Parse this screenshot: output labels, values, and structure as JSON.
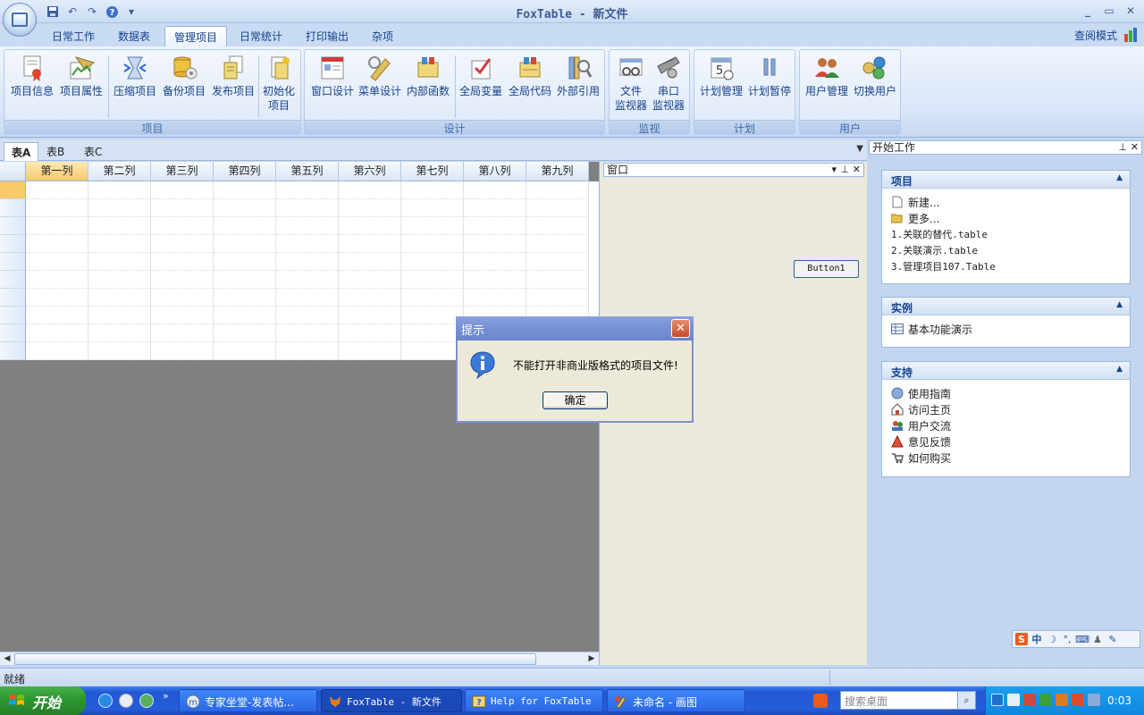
{
  "window": {
    "title": "FoxTable - 新文件"
  },
  "qat": {
    "save": "save-icon",
    "undo": "undo-icon",
    "redo": "redo-icon",
    "help": "help-icon",
    "more": "▾"
  },
  "ribbon": {
    "tabs": [
      "日常工作",
      "数据表",
      "管理项目",
      "日常统计",
      "打印输出",
      "杂项"
    ],
    "active_tab": "管理项目",
    "view_mode": "查阅模式",
    "groups": {
      "project": {
        "label": "项目",
        "buttons": [
          "项目信息",
          "项目属性",
          "压缩项目",
          "备份项目",
          "发布项目",
          "初始化",
          "项目"
        ]
      },
      "design": {
        "label": "设计",
        "buttons": [
          "窗口设计",
          "菜单设计",
          "内部函数",
          "全局变量",
          "全局代码",
          "外部引用"
        ]
      },
      "monitor": {
        "label": "监视",
        "buttons": [
          "文件",
          "监视器",
          "串口",
          "监视器"
        ]
      },
      "plan": {
        "label": "计划",
        "buttons": [
          "计划管理",
          "计划暂停"
        ]
      },
      "user": {
        "label": "用户",
        "buttons": [
          "用户管理",
          "切换用户"
        ]
      }
    }
  },
  "sheet_tabs": [
    "表A",
    "表B",
    "表C"
  ],
  "grid": {
    "columns": [
      "第一列",
      "第二列",
      "第三列",
      "第四列",
      "第五列",
      "第六列",
      "第七列",
      "第八列",
      "第九列"
    ]
  },
  "window_panel": {
    "title": "窗口",
    "button1": "Button1"
  },
  "task_pane": {
    "title": "开始工作",
    "project": {
      "title": "项目",
      "new": "新建...",
      "more": "更多...",
      "recent": [
        "1.关联的替代.table",
        "2.关联演示.table",
        "3.管理项目107.Table"
      ]
    },
    "examples": {
      "title": "实例",
      "items": [
        "基本功能演示"
      ]
    },
    "support": {
      "title": "支持",
      "items": [
        "使用指南",
        "访问主页",
        "用户交流",
        "意见反馈",
        "如何购买"
      ]
    }
  },
  "ime": {
    "label": "中"
  },
  "statusbar": {
    "text": "就绪"
  },
  "dialog": {
    "title": "提示",
    "message": "不能打开非商业版格式的项目文件!",
    "ok": "确定"
  },
  "taskbar": {
    "start": "开始",
    "buttons": [
      "专家坐堂-发表帖...",
      "FoxTable - 新文件",
      "Help for FoxTable",
      "未命名 - 画图"
    ],
    "search_placeholder": "搜索桌面",
    "clock": "0:03"
  }
}
